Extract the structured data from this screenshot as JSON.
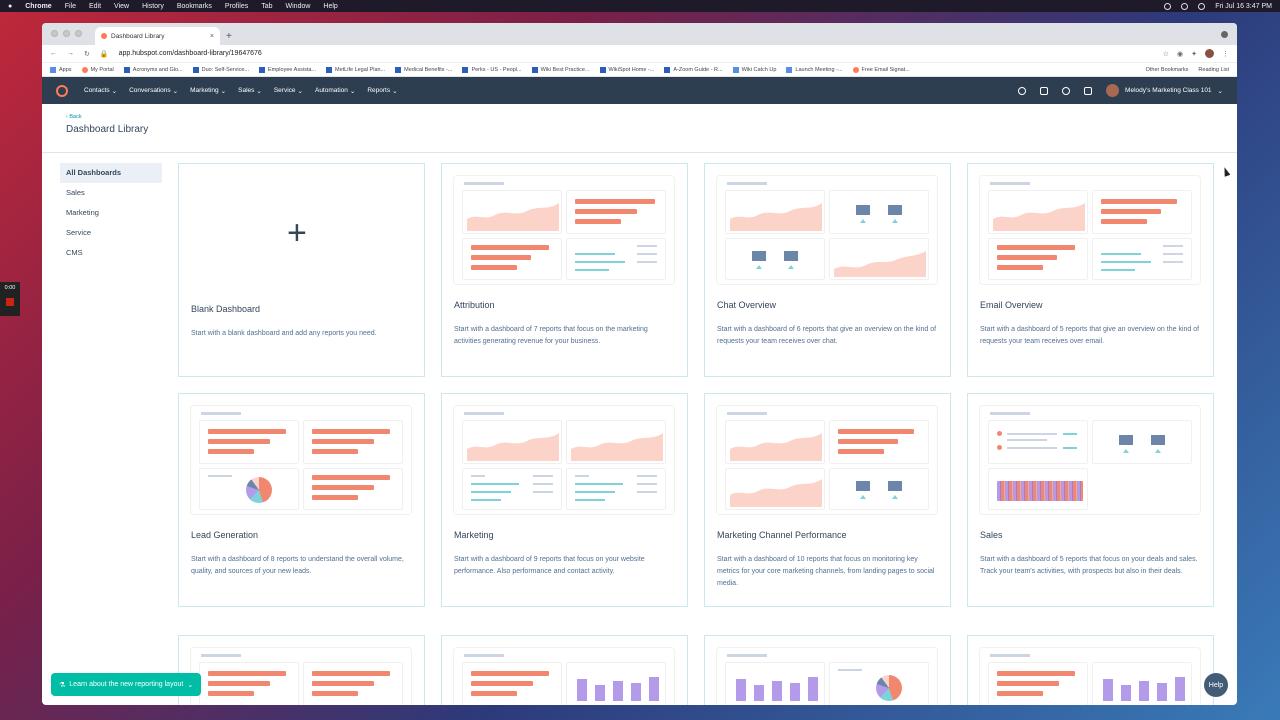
{
  "menubar": {
    "items": [
      "Chrome",
      "File",
      "Edit",
      "View",
      "History",
      "Bookmarks",
      "Profiles",
      "Tab",
      "Window",
      "Help"
    ],
    "datetime": "Fri Jul 16  3:47 PM"
  },
  "browser": {
    "tab_title": "Dashboard Library",
    "url": "app.hubspot.com/dashboard-library/19647676",
    "bookmarks": [
      "Apps",
      "My Portal",
      "Acronyms and Glo...",
      "Duo: Self-Service...",
      "Employee Assista...",
      "MetLife Legal Plan...",
      "Medical Benefits -...",
      "Perks - US - Peopl...",
      "Wiki Best Practice...",
      "WikiSpot Home -...",
      "A-Zoom Guide - R...",
      "Wiki Catch Up",
      "Launch Meeting -...",
      "Free Email Signat..."
    ],
    "other_bookmarks": "Other Bookmarks",
    "reading_list": "Reading List"
  },
  "nav": {
    "items": [
      "Contacts",
      "Conversations",
      "Marketing",
      "Sales",
      "Service",
      "Automation",
      "Reports"
    ],
    "account": "Melody's Marketing Class 101"
  },
  "header": {
    "back": "‹ Back",
    "title": "Dashboard Library"
  },
  "sidebar": {
    "items": [
      {
        "label": "All Dashboards",
        "active": true
      },
      {
        "label": "Sales"
      },
      {
        "label": "Marketing"
      },
      {
        "label": "Service"
      },
      {
        "label": "CMS"
      }
    ]
  },
  "cards": [
    {
      "title": "Blank Dashboard",
      "desc": "Start with a blank dashboard and add any reports you need."
    },
    {
      "title": "Attribution",
      "desc": "Start with a dashboard of 7 reports that focus on the marketing activities generating revenue for your business."
    },
    {
      "title": "Chat Overview",
      "desc": "Start with a dashboard of 6 reports that give an overview on the kind of requests your team receives over chat."
    },
    {
      "title": "Email Overview",
      "desc": "Start with a dashboard of 5 reports that give an overview on the kind of requests your team receives over email."
    },
    {
      "title": "Lead Generation",
      "desc": "Start with a dashboard of 8 reports to understand the overall volume, quality, and sources of your new leads."
    },
    {
      "title": "Marketing",
      "desc": "Start with a dashboard of 9 reports that focus on your website performance. Also performance and contact activity."
    },
    {
      "title": "Marketing Channel Performance",
      "desc": "Start with a dashboard of 10 reports that focus on monitoring key metrics for your core marketing channels, from landing pages to social media."
    },
    {
      "title": "Sales",
      "desc": "Start with a dashboard of 5 reports that focus on your deals and sales. Track your team's activities, with prospects but also in their deals."
    }
  ],
  "floating": {
    "learn": "Learn about the new reporting layout",
    "help": "Help"
  },
  "timer": "0:00",
  "colors": {
    "nav": "#2d3e50",
    "accent": "#ff7a59",
    "teal": "#00bda5",
    "bar": "#f2876f"
  }
}
